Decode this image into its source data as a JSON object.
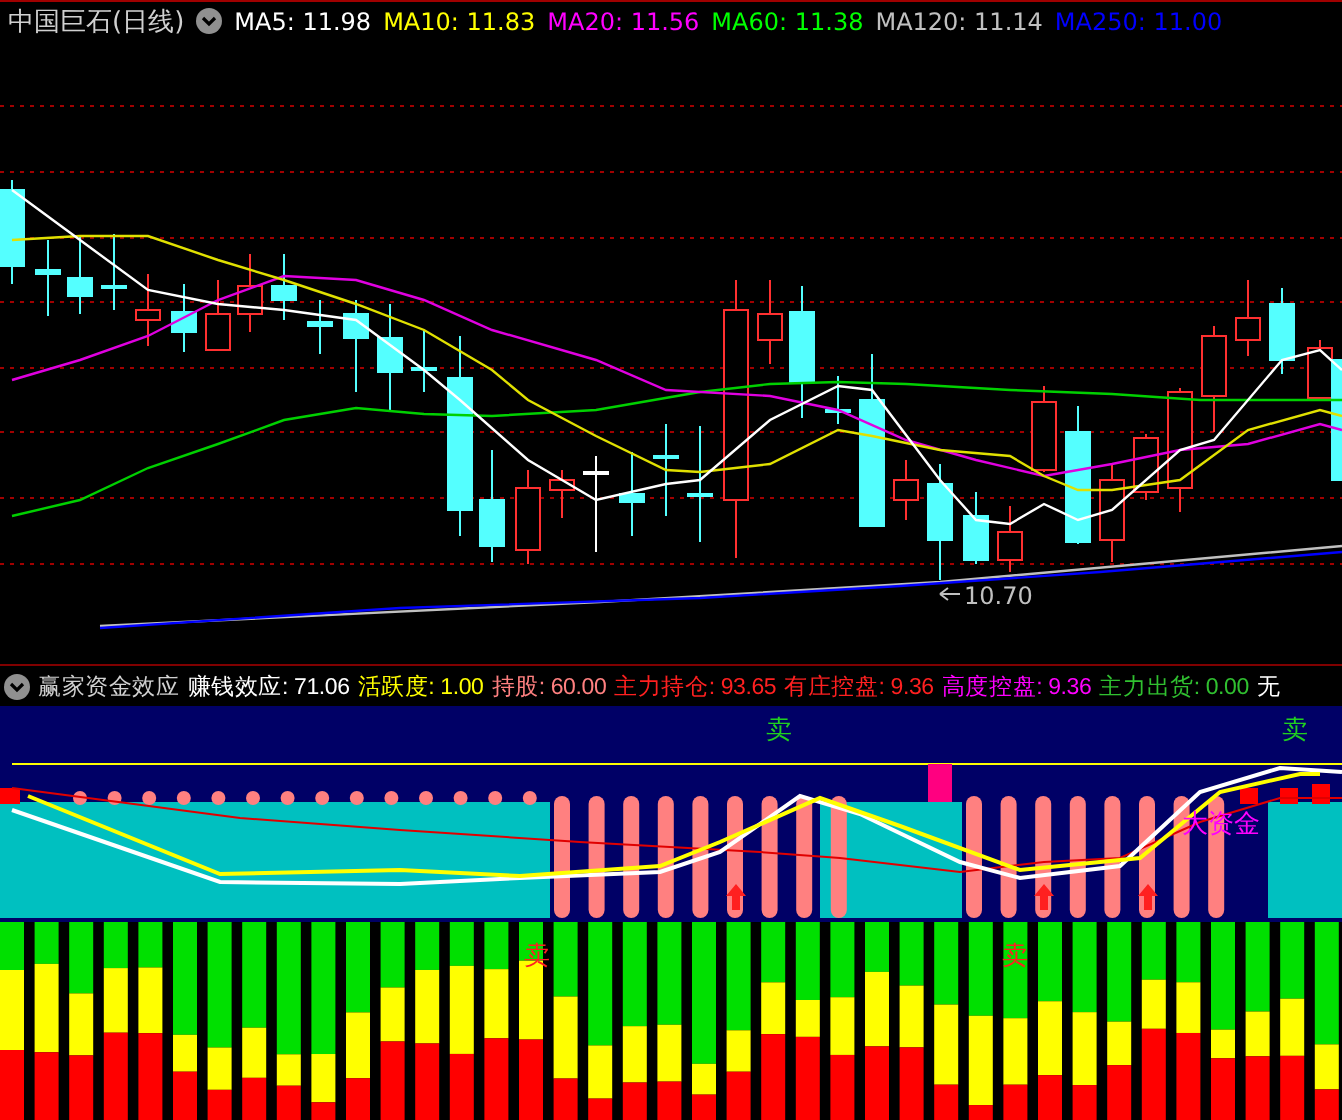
{
  "chart_title": "中国巨石(日线)",
  "ma_readings": [
    {
      "text": "MA5: 11.98",
      "color": "#ffffff"
    },
    {
      "text": "MA10: 11.83",
      "color": "#ffff00"
    },
    {
      "text": "MA20: 11.56",
      "color": "#ff00ff"
    },
    {
      "text": "MA60: 11.38",
      "color": "#00ff00"
    },
    {
      "text": "MA120: 11.14",
      "color": "#c0c0c0"
    },
    {
      "text": "MA250: 11.00",
      "color": "#0000ff"
    }
  ],
  "low_marker": "10.70",
  "indicator": {
    "name": "赢家资金效应",
    "readings": [
      {
        "text": "赚钱效应: 71.06",
        "color": "#ffffff"
      },
      {
        "text": "活跃度: 1.00",
        "color": "#ffff00"
      },
      {
        "text": "持股: 60.00",
        "color": "#ff8080"
      },
      {
        "text": "主力持仓: 93.65",
        "color": "#ff2020"
      },
      {
        "text": "有庄控盘: 9.36",
        "color": "#ff2020"
      },
      {
        "text": "高度控盘: 9.36",
        "color": "#ff00ff"
      },
      {
        "text": "主力出货: 0.00",
        "color": "#30c030"
      },
      {
        "text": "无",
        "color": "#ffffff"
      }
    ],
    "sell_signals": [
      "卖",
      "卖"
    ],
    "tag": "大资金"
  },
  "volume_signals": [
    "卖",
    "卖"
  ]
}
